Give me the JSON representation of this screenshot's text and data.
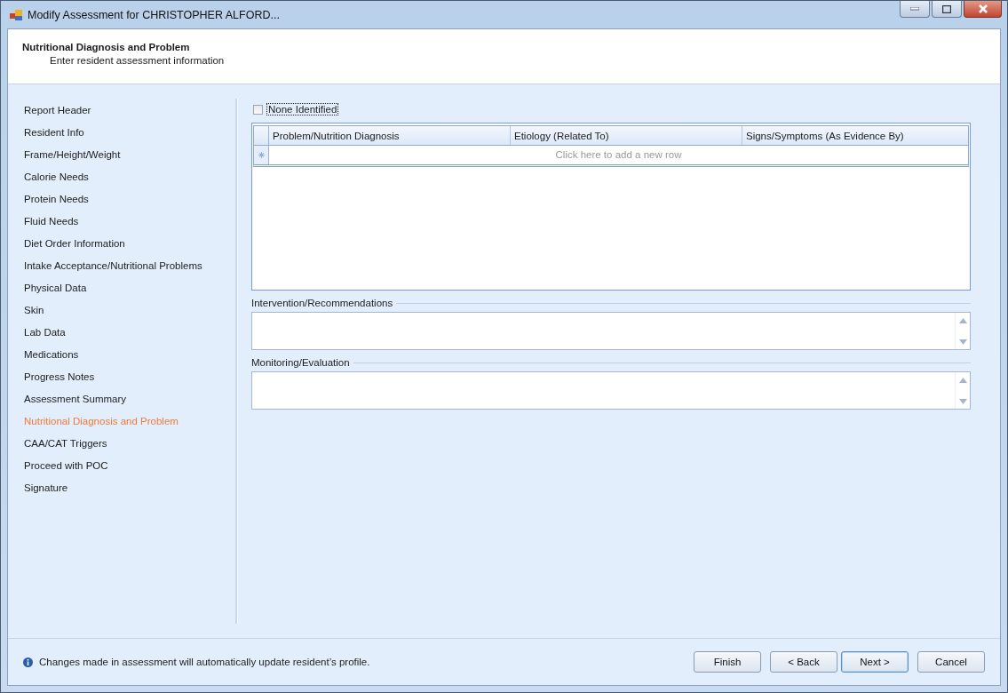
{
  "window": {
    "title": "Modify Assessment for CHRISTOPHER ALFORD..."
  },
  "header": {
    "title": "Nutritional Diagnosis and Problem",
    "subtitle": "Enter resident assessment information"
  },
  "sidebar": {
    "items": [
      {
        "label": "Report Header",
        "selected": false
      },
      {
        "label": "Resident Info",
        "selected": false
      },
      {
        "label": "Frame/Height/Weight",
        "selected": false
      },
      {
        "label": "Calorie Needs",
        "selected": false
      },
      {
        "label": "Protein Needs",
        "selected": false
      },
      {
        "label": "Fluid Needs",
        "selected": false
      },
      {
        "label": "Diet Order Information",
        "selected": false
      },
      {
        "label": "Intake Acceptance/Nutritional Problems",
        "selected": false
      },
      {
        "label": "Physical Data",
        "selected": false
      },
      {
        "label": "Skin",
        "selected": false
      },
      {
        "label": "Lab Data",
        "selected": false
      },
      {
        "label": "Medications",
        "selected": false
      },
      {
        "label": "Progress Notes",
        "selected": false
      },
      {
        "label": "Assessment Summary",
        "selected": false
      },
      {
        "label": "Nutritional Diagnosis and Problem",
        "selected": true
      },
      {
        "label": "CAA/CAT Triggers",
        "selected": false
      },
      {
        "label": "Proceed with POC",
        "selected": false
      },
      {
        "label": "Signature",
        "selected": false
      }
    ]
  },
  "none_identified": {
    "label": "None Identified",
    "checked": false
  },
  "grid": {
    "columns": [
      "Problem/Nutrition Diagnosis",
      "Etiology (Related To)",
      "Signs/Symptoms (As Evidence By)"
    ],
    "new_row_text": "Click here to add a new row"
  },
  "sections": [
    {
      "label": "Intervention/Recommendations"
    },
    {
      "label": "Monitoring/Evaluation"
    }
  ],
  "footer": {
    "info": "Changes made in assessment will automatically update resident’s profile.",
    "buttons": [
      {
        "label": "Finish",
        "default": false
      },
      {
        "label": "< Back",
        "default": false
      },
      {
        "label": "Next >",
        "default": true
      },
      {
        "label": "Cancel",
        "default": false
      }
    ]
  }
}
